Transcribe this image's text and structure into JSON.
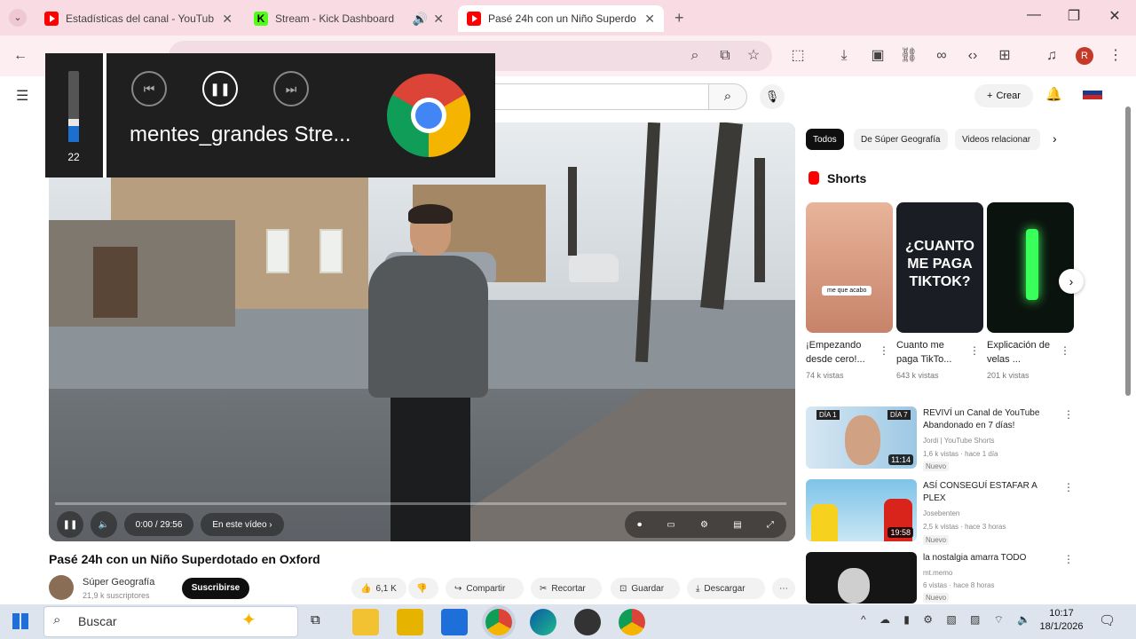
{
  "browser": {
    "tabs": [
      {
        "title": "Estadísticas del canal - YouTub",
        "icon": "youtube-icon",
        "audio": false
      },
      {
        "title": "Stream - Kick Dashboard",
        "icon": "kick-icon",
        "audio": true
      },
      {
        "title": "Pasé 24h con un Niño Superdo",
        "icon": "youtube-icon",
        "audio": false,
        "active": true
      }
    ],
    "new_tab": "+",
    "profile_initial": "R"
  },
  "media_overlay": {
    "volume": "22",
    "volume_fraction": 0.22,
    "title": "mentes_grandes Stre...",
    "app_icon": "chrome-icon"
  },
  "youtube": {
    "create_label": "Crear",
    "video": {
      "time": "0:00 / 29:56",
      "chapter": "En este vídeo",
      "title": "Pasé 24h con un Niño Superdotado en Oxford",
      "channel": "Súper Geografía",
      "subs": "21,9 k suscriptores",
      "subscribe": "Suscribirse",
      "likes": "6,1 K",
      "share": "Compartir",
      "clip": "Recortar",
      "save": "Guardar",
      "download": "Descargar"
    },
    "chips": [
      "Todos",
      "De Súper Geografía",
      "Videos relacionar"
    ],
    "shorts_label": "Shorts",
    "shorts": [
      {
        "title": "¡Empezando desde cero!...",
        "views": "74 k vistas",
        "badge": "me que acabo"
      },
      {
        "title": "Cuanto me paga TikTo...",
        "views": "643 k vistas",
        "overlay": "¿CUANTO ME PAGA TIKTOK?"
      },
      {
        "title": "Explicación de velas ...",
        "views": "201 k vistas"
      }
    ],
    "related": [
      {
        "title": "REVIVÍ un Canal de YouTube Abandonado en 7 días!",
        "channel": "Jordi | YouTube Shorts",
        "meta": "1,6 k vistas · hace 1 día",
        "badge": "Nuevo",
        "duration": "11:14",
        "label1": "DÍA 1",
        "label2": "DÍA 7"
      },
      {
        "title": "ASÍ CONSEGUÍ ESTAFAR A PLEX",
        "channel": "Josebenten",
        "meta": "2,5 k vistas · hace 3 horas",
        "badge": "Nuevo",
        "duration": "19:58"
      },
      {
        "title": "la nostalgia amarra TODO",
        "channel": "mt.memo",
        "meta": "6 vistas · hace 8 horas",
        "badge": "Nuevo",
        "duration": ""
      }
    ]
  },
  "taskbar": {
    "search_placeholder": "Buscar",
    "time": "10:17",
    "date": "18/1/2026"
  }
}
